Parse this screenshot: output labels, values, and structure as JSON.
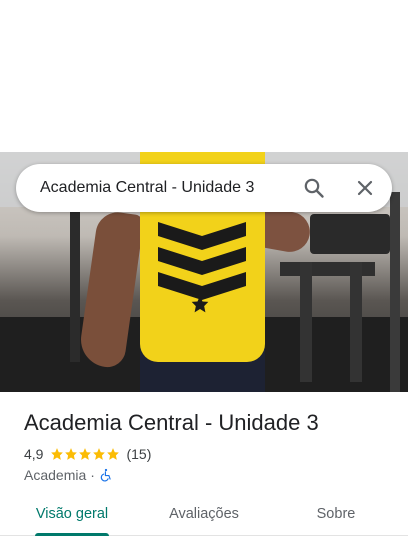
{
  "search": {
    "query": "Academia Central - Unidade 3",
    "search_icon": "search-icon",
    "close_icon": "close-icon"
  },
  "place": {
    "name": "Academia Central - Unidade 3",
    "rating": "4,9",
    "rating_stars": 5,
    "review_count": "(15)",
    "category": "Academia",
    "separator": "·",
    "accessibility_icon": "wheelchair-icon"
  },
  "tabs": [
    {
      "label": "Visão geral",
      "active": true
    },
    {
      "label": "Avaliações",
      "active": false
    },
    {
      "label": "Sobre",
      "active": false
    }
  ],
  "colors": {
    "accent": "#00796b",
    "star": "#fbbc04",
    "accessibility": "#1a73e8",
    "shirt": "#f2d21a"
  }
}
